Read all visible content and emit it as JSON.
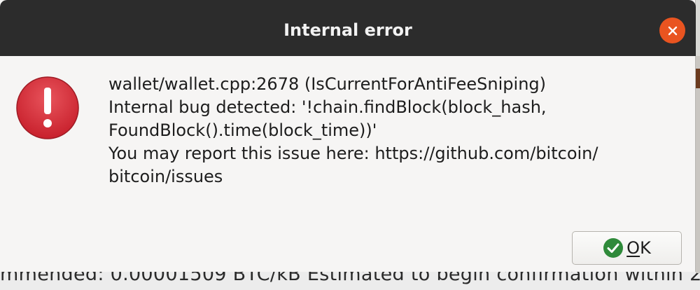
{
  "background": {
    "partial_text": "mmended: 0.00001509 BTC/kB  Estimated to begin confirmation within 2"
  },
  "dialog": {
    "title": "Internal error",
    "close_icon": "close-icon",
    "error_icon": "error-exclamation-icon",
    "message_lines": [
      "wallet/wallet.cpp:2678 (IsCurrentForAntiFeeSniping)",
      "Internal bug detected: '!chain.findBlock(block_hash,",
      "FoundBlock().time(block_time))'",
      "You may report this issue here: https://github.com/bitcoin/",
      "bitcoin/issues"
    ],
    "ok_button": {
      "label_mnemonic": "O",
      "label_rest": "K",
      "icon": "check-circle-icon"
    }
  },
  "colors": {
    "titlebar": "#2c2c2c",
    "close_button": "#e95420",
    "error_icon": "#d7303a",
    "ok_check": "#2f8a3a",
    "dialog_bg": "#f6f5f4"
  }
}
